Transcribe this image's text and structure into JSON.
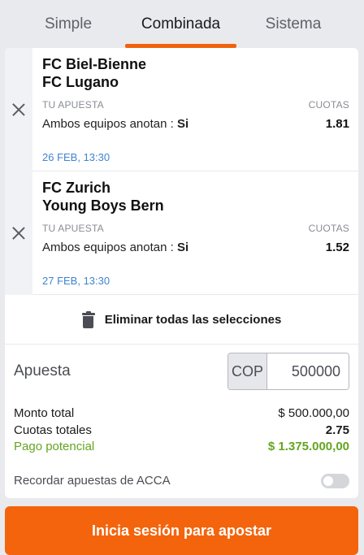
{
  "tabs": [
    {
      "label": "Simple",
      "active": false
    },
    {
      "label": "Combinada",
      "active": true
    },
    {
      "label": "Sistema",
      "active": false
    }
  ],
  "selections": [
    {
      "home_team": "FC Biel-Bienne",
      "away_team": "FC Lugano",
      "bet_label": "TU APUESTA",
      "odds_label": "CUOTAS",
      "market": "Ambos equipos anotan :",
      "pick": "Si",
      "odds": "1.81",
      "datetime": "26 FEB, 13:30"
    },
    {
      "home_team": "FC Zurich",
      "away_team": "Young Boys Bern",
      "bet_label": "TU APUESTA",
      "odds_label": "CUOTAS",
      "market": "Ambos equipos anotan :",
      "pick": "Si",
      "odds": "1.52",
      "datetime": "27 FEB, 13:30"
    }
  ],
  "clear_all_label": "Eliminar todas las selecciones",
  "stake": {
    "label": "Apuesta",
    "currency": "COP",
    "value": "500000"
  },
  "summary": {
    "total_stake_label": "Monto total",
    "total_stake_value": "$ 500.000,00",
    "total_odds_label": "Cuotas totales",
    "total_odds_value": "2.75",
    "potential_payout_label": "Pago potencial",
    "potential_payout_value": "$ 1.375.000,00"
  },
  "remember": {
    "label": "Recordar apuestas de ACCA",
    "enabled": false
  },
  "cta_label": "Inicia sesión para apostar",
  "colors": {
    "accent": "#f4640c",
    "date": "#3f84cf",
    "payout": "#63a61f",
    "background": "#e9eaee"
  },
  "icons": {
    "remove": "close-icon",
    "clear_all": "trash-icon"
  }
}
